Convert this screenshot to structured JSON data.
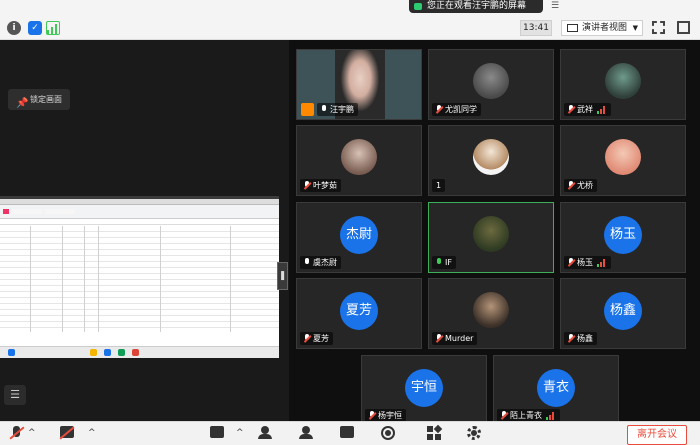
{
  "topbar": {
    "share_banner": "您正在观看汪宇鹏的屏幕",
    "clock": "13:41",
    "view_label": "演讲者视图",
    "icons": [
      "info-icon",
      "shield-icon",
      "signal-icon",
      "fullscreen-icon",
      "grid-icon"
    ]
  },
  "share_area": {
    "lock_label": "锁定画面"
  },
  "tiles": [
    {
      "name": "汪宇鹏",
      "avatar": "",
      "type": "video",
      "mic": "on-white",
      "host": true
    },
    {
      "name": "尤凯同学",
      "avatar": "",
      "type": "photo",
      "mic": "muted"
    },
    {
      "name": "武祥",
      "avatar": "",
      "type": "photo",
      "mic": "muted",
      "signal": true
    },
    {
      "name": "叶梦茹",
      "avatar": "",
      "type": "photo",
      "mic": "muted"
    },
    {
      "name": "1",
      "avatar": "",
      "type": "photo",
      "mic": "none"
    },
    {
      "name": "尤桥",
      "avatar": "",
      "type": "photo",
      "mic": "muted"
    },
    {
      "name": "虞杰尉",
      "avatar": "杰尉",
      "type": "circle",
      "mic": "on-white"
    },
    {
      "name": "IF",
      "avatar": "",
      "type": "photo",
      "mic": "on",
      "active": true
    },
    {
      "name": "杨玉",
      "avatar": "杨玉",
      "type": "circle",
      "mic": "muted",
      "signal": true
    },
    {
      "name": "夏芳",
      "avatar": "夏芳",
      "type": "circle",
      "mic": "muted"
    },
    {
      "name": "Murder",
      "avatar": "",
      "type": "photo",
      "mic": "muted"
    },
    {
      "name": "杨鑫",
      "avatar": "杨鑫",
      "type": "circle",
      "mic": "muted"
    },
    {
      "name": "杨宇恒",
      "avatar": "宇恒",
      "type": "circle",
      "mic": "muted"
    },
    {
      "name": "陌上青衣",
      "avatar": "青衣",
      "type": "circle",
      "mic": "muted",
      "signal": true
    }
  ],
  "colors": {
    "accent": "#1a73e8",
    "leave": "#e74c3c",
    "active_border": "#3fae5a"
  },
  "toolbar": {
    "leave_label": "离开会议"
  }
}
